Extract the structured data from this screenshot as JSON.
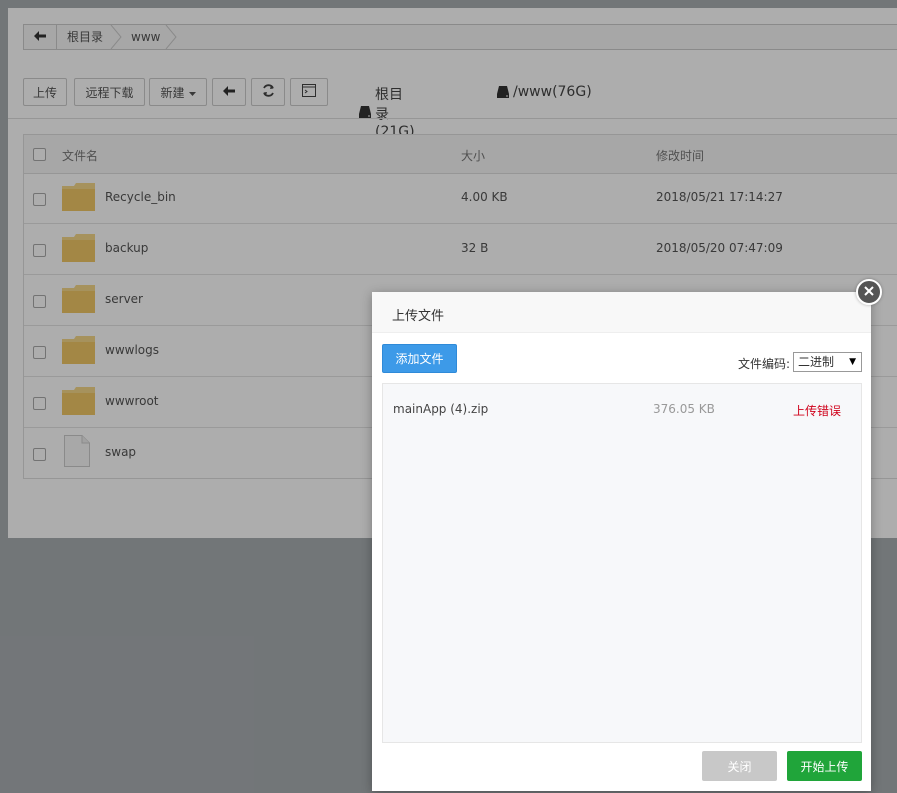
{
  "breadcrumb": {
    "back_icon": "arrow-left-icon",
    "items": [
      "根目录",
      "www"
    ]
  },
  "toolbar": {
    "upload": "上传",
    "remote_download": "远程下载",
    "new": "新建",
    "back_icon": "arrow-left-icon",
    "refresh_icon": "refresh-icon",
    "terminal_icon": "terminal-icon",
    "disks": [
      {
        "label": "根目录(21G)",
        "icon": "hdd-icon"
      },
      {
        "label": "/www(76G)",
        "icon": "hdd-icon"
      }
    ]
  },
  "table": {
    "headers": {
      "name": "文件名",
      "size": "大小",
      "mtime": "修改时间"
    },
    "rows": [
      {
        "name": "Recycle_bin",
        "size": "4.00 KB",
        "mtime": "2018/05/21 17:14:27",
        "type": "folder"
      },
      {
        "name": "backup",
        "size": "32 B",
        "mtime": "2018/05/20 07:47:09",
        "type": "folder"
      },
      {
        "name": "server",
        "size": "",
        "mtime": "",
        "type": "folder"
      },
      {
        "name": "wwwlogs",
        "size": "",
        "mtime": "",
        "type": "folder"
      },
      {
        "name": "wwwroot",
        "size": "",
        "mtime": "",
        "type": "folder"
      },
      {
        "name": "swap",
        "size": "",
        "mtime": "",
        "type": "file"
      }
    ]
  },
  "dialog": {
    "title": "上传文件",
    "add_files": "添加文件",
    "encoding_label": "文件编码:",
    "encoding_value": "二进制",
    "close_icon": "close-icon",
    "files": [
      {
        "name": "mainApp (4).zip",
        "size": "376.05 KB",
        "status": "上传错误"
      }
    ],
    "close_button": "关闭",
    "start_button": "开始上传",
    "colors": {
      "primary": "#3d9ae8",
      "success": "#20a53a",
      "error": "#d0021b",
      "disabled": "#c8c8c8"
    }
  }
}
